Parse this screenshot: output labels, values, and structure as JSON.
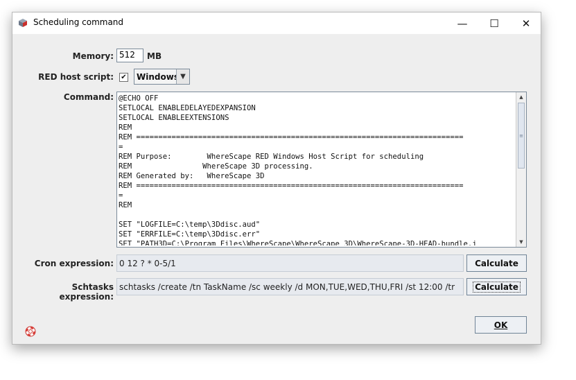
{
  "window": {
    "title": "Scheduling command",
    "controls": {
      "minimize": "—",
      "maximize": "☐",
      "close": "✕"
    }
  },
  "memory": {
    "label": "Memory:",
    "value": "512",
    "unit": "MB"
  },
  "red_host_script": {
    "label": "RED host script:",
    "checked": true,
    "check_mark": "✔",
    "os_selected": "Windows",
    "arrow": "▼"
  },
  "command": {
    "label": "Command:",
    "lines": [
      "@ECHO OFF",
      "SETLOCAL ENABLEDELAYEDEXPANSION",
      "SETLOCAL ENABLEEXTENSIONS",
      "REM",
      "REM ==========================================================================",
      "=",
      "REM Purpose:        WhereScape RED Windows Host Script for scheduling",
      "REM                WhereScape 3D processing.",
      "REM Generated by:   WhereScape 3D",
      "REM ==========================================================================",
      "=",
      "REM",
      "",
      "SET \"LOGFILE=C:\\temp\\3Ddisc.aud\"",
      "SET \"ERRFILE=C:\\temp\\3Ddisc.err\"",
      "SET \"PATH3D=C:\\Program Files\\WhereScape\\WhereScape 3D\\WhereScape-3D-HEAD-bundle.j"
    ],
    "scroll_up": "▲",
    "scroll_down": "▼",
    "thumb_grip": "≡"
  },
  "cron": {
    "label": "Cron expression:",
    "value": "0 12 ? * 0-5/1",
    "button": "Calculate"
  },
  "schtasks": {
    "label": "Schtasks expression:",
    "value": "schtasks /create /tn TaskName /sc weekly /d MON,TUE,WED,THU,FRI /st 12:00 /tr",
    "button": "Calculate"
  },
  "footer": {
    "ok": "OK"
  },
  "colors": {
    "dialog_bg": "#eeeeee",
    "button_border": "#6f8396",
    "expr_bg": "#e7eaef"
  }
}
